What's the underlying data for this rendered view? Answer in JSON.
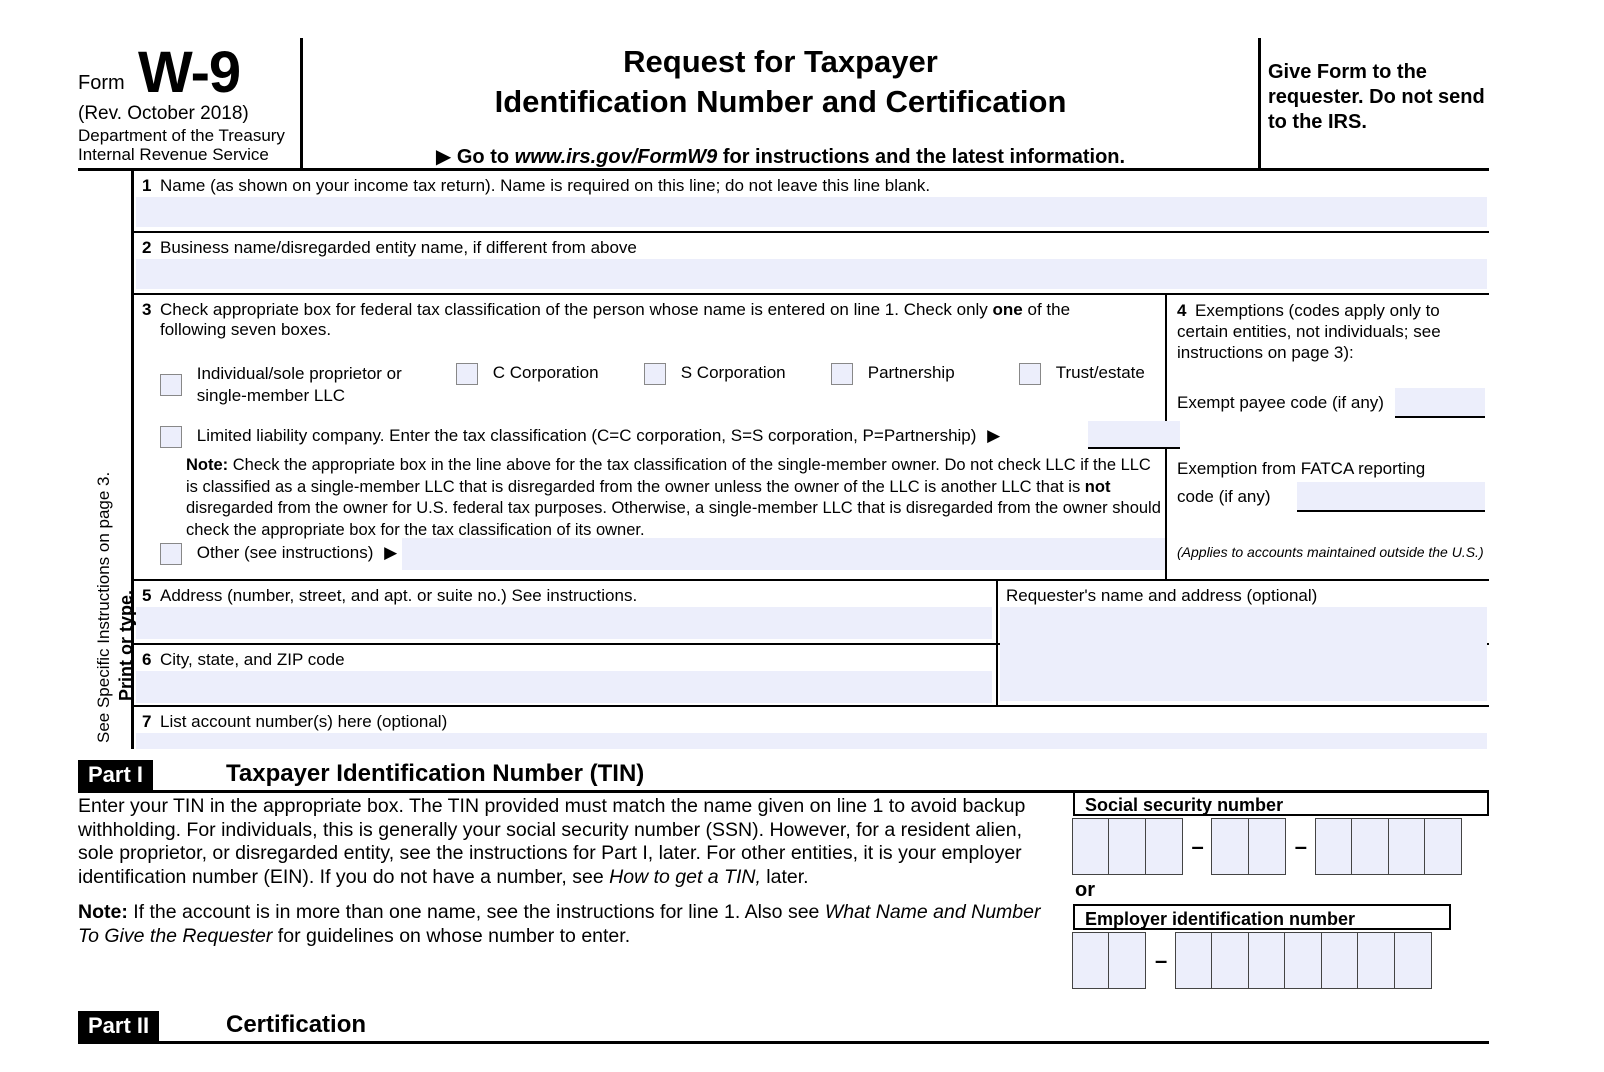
{
  "form": {
    "form_word": "Form",
    "number": "W-9",
    "revision": "(Rev. October 2018)",
    "department_line1": "Department of the Treasury",
    "department_line2": "Internal Revenue Service",
    "title_line1": "Request for Taxpayer",
    "title_line2": "Identification Number and Certification",
    "goto_arrow": "▶",
    "goto_prefix": "Go to ",
    "goto_url": "www.irs.gov/FormW9",
    "goto_suffix": " for instructions and the latest information.",
    "give_form_note": "Give Form to the requester. Do not send to the IRS."
  },
  "sidebar": {
    "line_a": "Print or type.",
    "line_b": "See Specific Instructions on page 3."
  },
  "lines": {
    "line1": {
      "number": "1",
      "label": "Name (as shown on your income tax return). Name is required on this line; do not leave this line blank.",
      "value": ""
    },
    "line2": {
      "number": "2",
      "label": "Business name/disregarded entity name, if different from above",
      "value": ""
    },
    "line3": {
      "number": "3",
      "label_part1": "Check appropriate box for federal tax classification of the person whose name is entered on line 1. Check only ",
      "label_bold": "one",
      "label_part2": " of the",
      "label_line2": "following seven boxes.",
      "checkboxes": [
        {
          "id": "individual",
          "label_line1": "Individual/sole proprietor or",
          "label_line2": "single-member LLC",
          "checked": false
        },
        {
          "id": "c-corporation",
          "label_line1": "C Corporation",
          "label_line2": "",
          "checked": false
        },
        {
          "id": "s-corporation",
          "label_line1": "S Corporation",
          "label_line2": "",
          "checked": false
        },
        {
          "id": "partnership",
          "label_line1": "Partnership",
          "label_line2": "",
          "checked": false
        },
        {
          "id": "trust-estate",
          "label_line1": "Trust/estate",
          "label_line2": "",
          "checked": false
        }
      ],
      "llc": {
        "label": "Limited liability company. Enter the tax classification (C=C corporation, S=S corporation, P=Partnership)",
        "arrow": "▶",
        "value": "",
        "checked": false
      },
      "note_bold": "Note:",
      "note_text_1": " Check the appropriate box in the line above for the tax classification of the single-member owner.  Do not check LLC if the LLC is classified as a single-member LLC that is disregarded from the owner unless the owner of the LLC is another LLC that is ",
      "note_bold_2": "not",
      "note_text_2": " disregarded from the owner for U.S. federal tax purposes. Otherwise, a single-member LLC that is disregarded from the owner should check the appropriate box for the tax classification of its owner.",
      "other": {
        "label": "Other (see instructions)",
        "arrow": "▶",
        "value": "",
        "checked": false
      }
    },
    "line4": {
      "number": "4",
      "label_line1": "Exemptions (codes apply only to",
      "label_line2": "certain entities, not individuals; see",
      "label_line3": "instructions on page 3):",
      "exempt_payee_label": "Exempt payee code (if any)",
      "exempt_payee_value": "",
      "fatca_label_line1": "Exemption from FATCA reporting",
      "fatca_label_line2": "code (if any)",
      "fatca_value": "",
      "applies_note": "(Applies to accounts maintained outside the U.S.)"
    },
    "line5": {
      "number": "5",
      "label": "Address (number, street, and apt. or suite no.) See instructions.",
      "value": ""
    },
    "line6": {
      "number": "6",
      "label": "City, state, and ZIP code",
      "value": ""
    },
    "line7": {
      "number": "7",
      "label": "List account number(s) here (optional)",
      "value": ""
    },
    "requester": {
      "label": "Requester's name and address (optional)",
      "value": ""
    }
  },
  "part1": {
    "tag": "Part I",
    "title": "Taxpayer Identification Number (TIN)",
    "para1_a": "Enter your TIN in the appropriate box. The TIN provided must match the name given on line 1 to avoid backup withholding. For individuals, this is generally your social security number (SSN). However, for a resident alien, sole proprietor, or disregarded entity, see the instructions for Part I, later. For other entities, it is your employer identification number (EIN). If you do not have a number, see ",
    "para1_italic": "How to get a TIN,",
    "para1_b": " later.",
    "note_bold": "Note:",
    "note_a": " If the account is in more than one name, see the instructions for line 1. Also see ",
    "note_italic": "What Name and Number To Give the Requester",
    "note_b": " for guidelines on whose number to enter.",
    "ssn_label": "Social security number",
    "ssn_groups": [
      3,
      2,
      4
    ],
    "ssn_value": "",
    "or_label": "or",
    "ein_label": "Employer identification number",
    "ein_groups": [
      2,
      7
    ],
    "ein_value": "",
    "dash": "–"
  },
  "part2": {
    "tag": "Part II",
    "title": "Certification"
  },
  "colors": {
    "field_fill": "#eceefb",
    "checkbox_border": "#888888",
    "rule": "#000000"
  }
}
